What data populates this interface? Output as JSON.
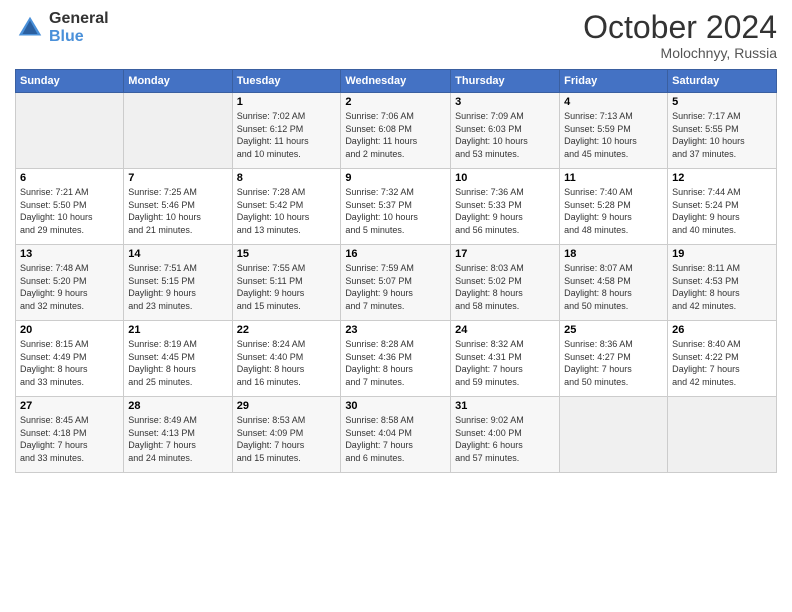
{
  "logo": {
    "line1": "General",
    "line2": "Blue"
  },
  "header": {
    "month": "October 2024",
    "location": "Molochnyy, Russia"
  },
  "days_of_week": [
    "Sunday",
    "Monday",
    "Tuesday",
    "Wednesday",
    "Thursday",
    "Friday",
    "Saturday"
  ],
  "weeks": [
    [
      {
        "day": "",
        "info": ""
      },
      {
        "day": "",
        "info": ""
      },
      {
        "day": "1",
        "info": "Sunrise: 7:02 AM\nSunset: 6:12 PM\nDaylight: 11 hours\nand 10 minutes."
      },
      {
        "day": "2",
        "info": "Sunrise: 7:06 AM\nSunset: 6:08 PM\nDaylight: 11 hours\nand 2 minutes."
      },
      {
        "day": "3",
        "info": "Sunrise: 7:09 AM\nSunset: 6:03 PM\nDaylight: 10 hours\nand 53 minutes."
      },
      {
        "day": "4",
        "info": "Sunrise: 7:13 AM\nSunset: 5:59 PM\nDaylight: 10 hours\nand 45 minutes."
      },
      {
        "day": "5",
        "info": "Sunrise: 7:17 AM\nSunset: 5:55 PM\nDaylight: 10 hours\nand 37 minutes."
      }
    ],
    [
      {
        "day": "6",
        "info": "Sunrise: 7:21 AM\nSunset: 5:50 PM\nDaylight: 10 hours\nand 29 minutes."
      },
      {
        "day": "7",
        "info": "Sunrise: 7:25 AM\nSunset: 5:46 PM\nDaylight: 10 hours\nand 21 minutes."
      },
      {
        "day": "8",
        "info": "Sunrise: 7:28 AM\nSunset: 5:42 PM\nDaylight: 10 hours\nand 13 minutes."
      },
      {
        "day": "9",
        "info": "Sunrise: 7:32 AM\nSunset: 5:37 PM\nDaylight: 10 hours\nand 5 minutes."
      },
      {
        "day": "10",
        "info": "Sunrise: 7:36 AM\nSunset: 5:33 PM\nDaylight: 9 hours\nand 56 minutes."
      },
      {
        "day": "11",
        "info": "Sunrise: 7:40 AM\nSunset: 5:28 PM\nDaylight: 9 hours\nand 48 minutes."
      },
      {
        "day": "12",
        "info": "Sunrise: 7:44 AM\nSunset: 5:24 PM\nDaylight: 9 hours\nand 40 minutes."
      }
    ],
    [
      {
        "day": "13",
        "info": "Sunrise: 7:48 AM\nSunset: 5:20 PM\nDaylight: 9 hours\nand 32 minutes."
      },
      {
        "day": "14",
        "info": "Sunrise: 7:51 AM\nSunset: 5:15 PM\nDaylight: 9 hours\nand 23 minutes."
      },
      {
        "day": "15",
        "info": "Sunrise: 7:55 AM\nSunset: 5:11 PM\nDaylight: 9 hours\nand 15 minutes."
      },
      {
        "day": "16",
        "info": "Sunrise: 7:59 AM\nSunset: 5:07 PM\nDaylight: 9 hours\nand 7 minutes."
      },
      {
        "day": "17",
        "info": "Sunrise: 8:03 AM\nSunset: 5:02 PM\nDaylight: 8 hours\nand 58 minutes."
      },
      {
        "day": "18",
        "info": "Sunrise: 8:07 AM\nSunset: 4:58 PM\nDaylight: 8 hours\nand 50 minutes."
      },
      {
        "day": "19",
        "info": "Sunrise: 8:11 AM\nSunset: 4:53 PM\nDaylight: 8 hours\nand 42 minutes."
      }
    ],
    [
      {
        "day": "20",
        "info": "Sunrise: 8:15 AM\nSunset: 4:49 PM\nDaylight: 8 hours\nand 33 minutes."
      },
      {
        "day": "21",
        "info": "Sunrise: 8:19 AM\nSunset: 4:45 PM\nDaylight: 8 hours\nand 25 minutes."
      },
      {
        "day": "22",
        "info": "Sunrise: 8:24 AM\nSunset: 4:40 PM\nDaylight: 8 hours\nand 16 minutes."
      },
      {
        "day": "23",
        "info": "Sunrise: 8:28 AM\nSunset: 4:36 PM\nDaylight: 8 hours\nand 7 minutes."
      },
      {
        "day": "24",
        "info": "Sunrise: 8:32 AM\nSunset: 4:31 PM\nDaylight: 7 hours\nand 59 minutes."
      },
      {
        "day": "25",
        "info": "Sunrise: 8:36 AM\nSunset: 4:27 PM\nDaylight: 7 hours\nand 50 minutes."
      },
      {
        "day": "26",
        "info": "Sunrise: 8:40 AM\nSunset: 4:22 PM\nDaylight: 7 hours\nand 42 minutes."
      }
    ],
    [
      {
        "day": "27",
        "info": "Sunrise: 8:45 AM\nSunset: 4:18 PM\nDaylight: 7 hours\nand 33 minutes."
      },
      {
        "day": "28",
        "info": "Sunrise: 8:49 AM\nSunset: 4:13 PM\nDaylight: 7 hours\nand 24 minutes."
      },
      {
        "day": "29",
        "info": "Sunrise: 8:53 AM\nSunset: 4:09 PM\nDaylight: 7 hours\nand 15 minutes."
      },
      {
        "day": "30",
        "info": "Sunrise: 8:58 AM\nSunset: 4:04 PM\nDaylight: 7 hours\nand 6 minutes."
      },
      {
        "day": "31",
        "info": "Sunrise: 9:02 AM\nSunset: 4:00 PM\nDaylight: 6 hours\nand 57 minutes."
      },
      {
        "day": "",
        "info": ""
      },
      {
        "day": "",
        "info": ""
      }
    ]
  ]
}
